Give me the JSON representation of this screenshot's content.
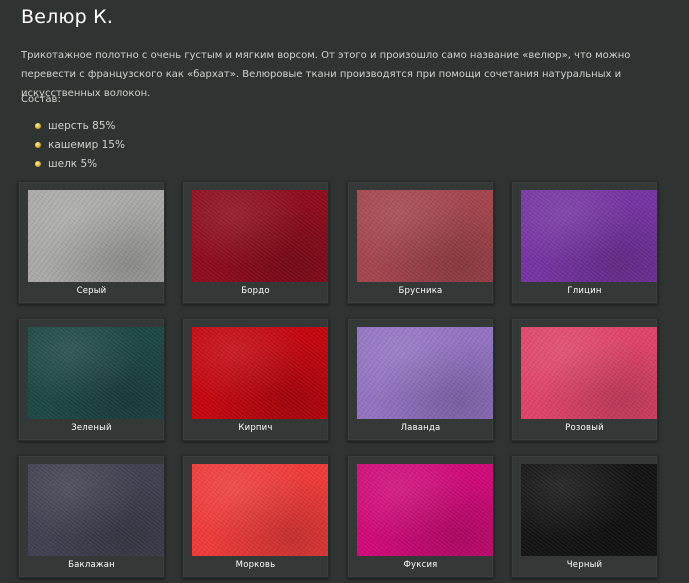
{
  "page": {
    "title": "Велюр К.",
    "description": "Трикотажное полотно с очень густым и мягким ворсом. От этого и произошло само название «велюр», что можно перевести с французского как «бархат». Велюровые ткани производятся при помощи сочетания натуральных и искусственных волокон.",
    "composition_heading": "Состав:",
    "composition": [
      "шерсть 85%",
      "кашемир 15%",
      "шелк 5%"
    ]
  },
  "swatches": [
    {
      "label": "Серый",
      "color": "#a9aaa7"
    },
    {
      "label": "Бордо",
      "color": "#8e0c1c"
    },
    {
      "label": "Брусника",
      "color": "#a4454e"
    },
    {
      "label": "Глицин",
      "color": "#7634a2"
    },
    {
      "label": "Зеленый",
      "color": "#1d4744"
    },
    {
      "label": "Кирпич",
      "color": "#c4060f"
    },
    {
      "label": "Лаванда",
      "color": "#9373c2"
    },
    {
      "label": "Розовый",
      "color": "#e04469"
    },
    {
      "label": "Баклажан",
      "color": "#3f4150"
    },
    {
      "label": "Морковь",
      "color": "#ef3b39"
    },
    {
      "label": "Фуксия",
      "color": "#d00a78"
    },
    {
      "label": "Черный",
      "color": "#141414"
    }
  ],
  "icons": {
    "bullet": "gold-bullet-icon"
  }
}
